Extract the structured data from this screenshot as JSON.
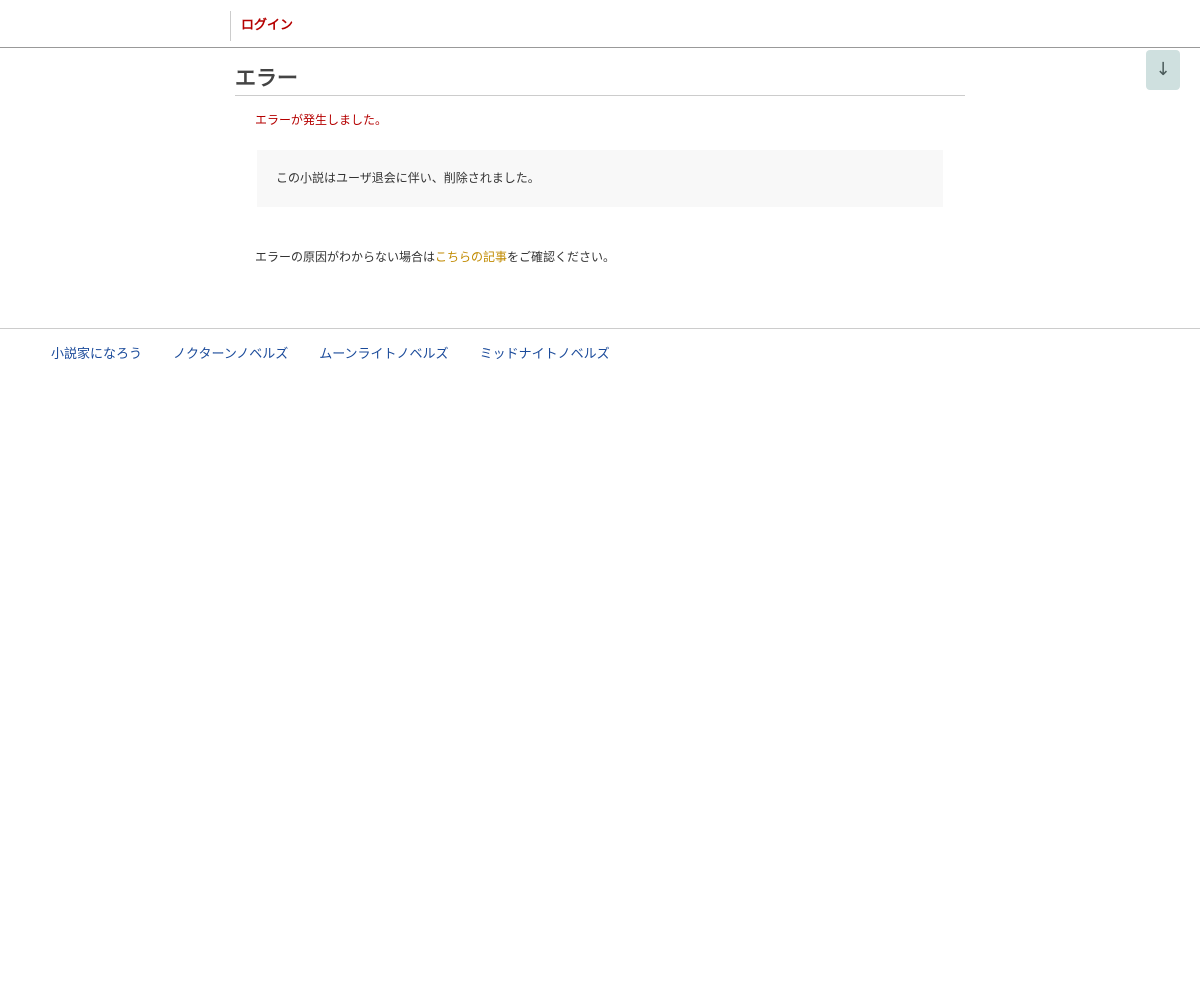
{
  "header": {
    "login_label": "ログイン"
  },
  "scroll_button": {
    "label": "↓"
  },
  "main": {
    "title": "エラー",
    "error_message": "エラーが発生しました。",
    "error_detail": "この小説はユーザ退会に伴い、削除されました。",
    "help_prefix": "エラーの原因がわからない場合は",
    "help_link_label": "こちらの記事",
    "help_suffix": "をご確認ください。"
  },
  "footer": {
    "links": [
      {
        "label": "小説家になろう"
      },
      {
        "label": "ノクターンノベルズ"
      },
      {
        "label": "ムーンライトノベルズ"
      },
      {
        "label": "ミッドナイトノベルズ"
      }
    ]
  },
  "colors": {
    "accent_red": "#b50000",
    "link_gold": "#c08a00",
    "footer_link_blue": "#1a4a9a",
    "scroll_button_bg": "#cfe0df"
  }
}
